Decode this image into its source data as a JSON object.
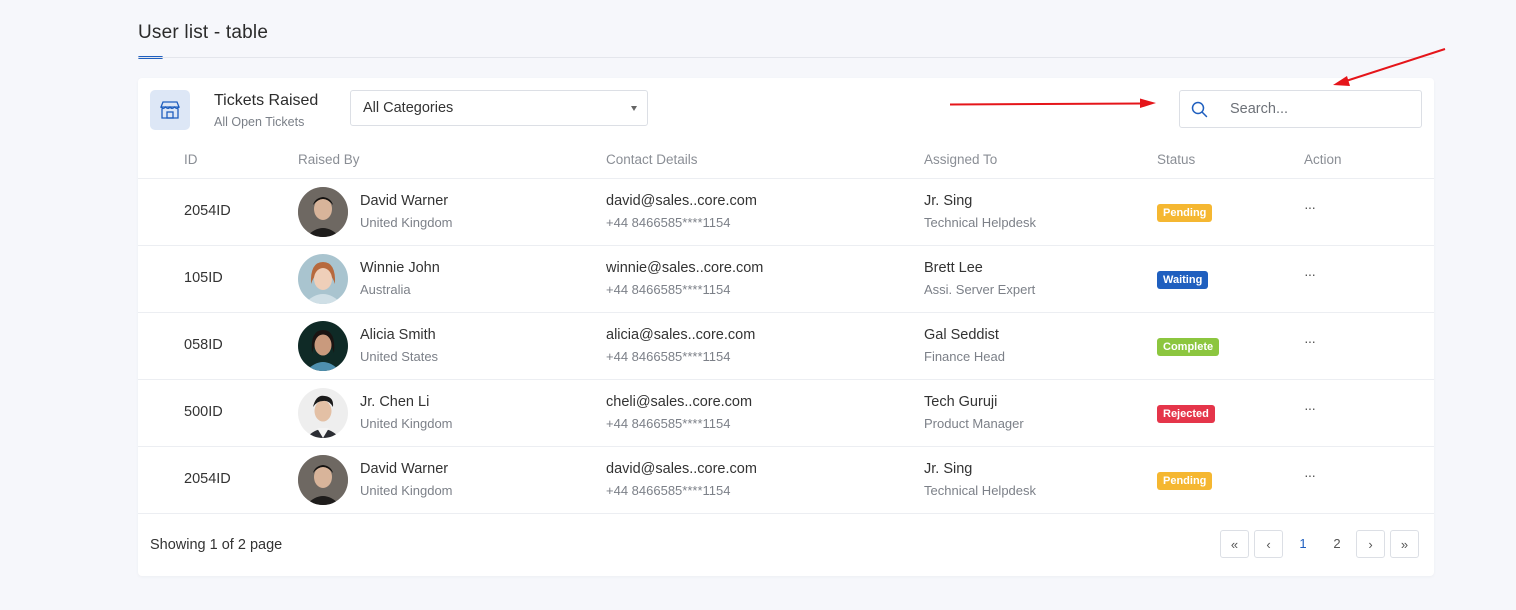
{
  "page": {
    "title": "User list - table"
  },
  "card": {
    "title": "Tickets Raised",
    "subtitle": "All Open Tickets",
    "category_select": {
      "selected": "All Categories"
    },
    "search": {
      "placeholder": "Search..."
    }
  },
  "table": {
    "headers": [
      "ID",
      "Raised By",
      "Contact Details",
      "Assigned To",
      "Status",
      "Action"
    ],
    "rows": [
      {
        "id": "2054ID",
        "name": "David Warner",
        "country": "United Kingdom",
        "email": "david@sales..core.com",
        "phone": "+44 8466585****1154",
        "assignee": "Jr. Sing",
        "assignee_role": "Technical Helpdesk",
        "status": "Pending",
        "status_color": "#f5b731",
        "action": "···"
      },
      {
        "id": "105ID",
        "name": "Winnie John",
        "country": "Australia",
        "email": "winnie@sales..core.com",
        "phone": "+44 8466585****1154",
        "assignee": "Brett Lee",
        "assignee_role": "Assi. Server Expert",
        "status": "Waiting",
        "status_color": "#1f5fbf",
        "action": "···"
      },
      {
        "id": "058ID",
        "name": "Alicia Smith",
        "country": "United States",
        "email": "alicia@sales..core.com",
        "phone": "+44 8466585****1154",
        "assignee": "Gal Seddist",
        "assignee_role": "Finance Head",
        "status": "Complete",
        "status_color": "#8cc63f",
        "action": "···"
      },
      {
        "id": "500ID",
        "name": "Jr. Chen Li",
        "country": "United Kingdom",
        "email": "cheli@sales..core.com",
        "phone": "+44 8466585****1154",
        "assignee": "Tech Guruji",
        "assignee_role": "Product Manager",
        "status": "Rejected",
        "status_color": "#e5354a",
        "action": "···"
      },
      {
        "id": "2054ID",
        "name": "David Warner",
        "country": "United Kingdom",
        "email": "david@sales..core.com",
        "phone": "+44 8466585****1154",
        "assignee": "Jr. Sing",
        "assignee_role": "Technical Helpdesk",
        "status": "Pending",
        "status_color": "#f5b731",
        "action": "···"
      }
    ]
  },
  "footer": {
    "showing_text": "Showing 1 of 2 page",
    "pagination": {
      "first": "«",
      "prev": "‹",
      "pages": [
        "1",
        "2"
      ],
      "current": "1",
      "next": "›",
      "last": "»"
    }
  },
  "colors": {
    "accent": "#1f5fbf",
    "annotation_arrow": "#e5151a"
  }
}
